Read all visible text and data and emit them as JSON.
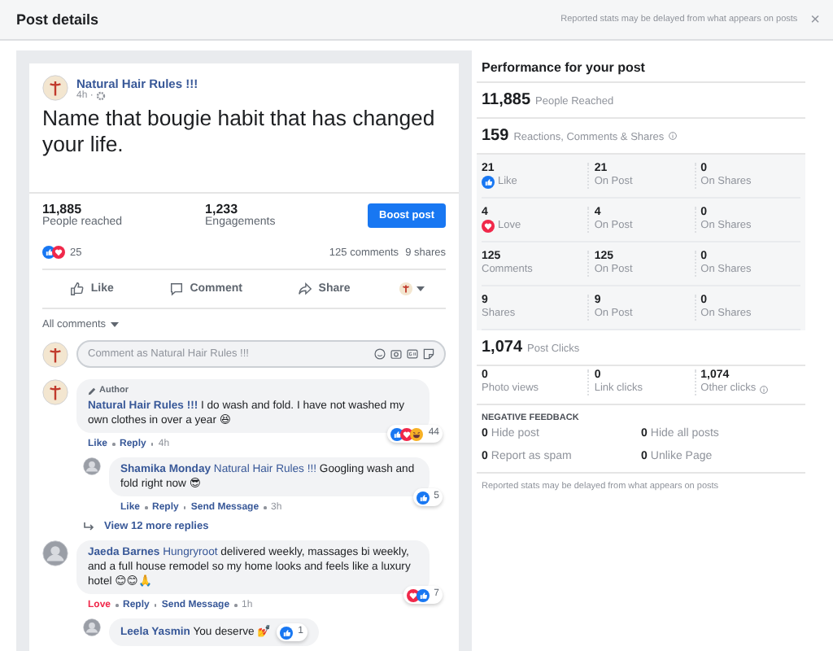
{
  "header": {
    "title": "Post details",
    "note": "Reported stats may be delayed from what appears on posts",
    "close": "×"
  },
  "post": {
    "page_name": "Natural Hair Rules !!!",
    "time": "4h ·",
    "text": "Name that bougie habit that has changed your life.",
    "stats": [
      {
        "value": "11,885",
        "label": "People reached"
      },
      {
        "value": "1,233",
        "label": "Engagements"
      }
    ],
    "boost_button": "Boost post",
    "reactions": {
      "kinds": [
        {
          "kind": "like"
        },
        {
          "kind": "love"
        }
      ],
      "count": "25"
    },
    "comments_count": "125 comments",
    "shares_count": "9 shares",
    "actions": [
      {
        "kind": "like",
        "label": "Like"
      },
      {
        "kind": "comment",
        "label": "Comment"
      },
      {
        "kind": "share",
        "label": "Share"
      }
    ],
    "filter": "All comments",
    "comment_placeholder": "Comment as Natural Hair Rules !!!",
    "comments": [
      {
        "badge": "Author",
        "name": "Natural Hair Rules !!!",
        "text": "I do wash and fold. I have not washed my own clothes in over a year 😆",
        "loved": false,
        "actions": [
          "Like",
          "Reply"
        ],
        "time": "4h",
        "reactions": [
          {
            "kind": "like"
          },
          {
            "kind": "love"
          },
          {
            "kind": "haha"
          }
        ],
        "reaction_count": "44",
        "children": [
          {
            "name": "Shamika Monday",
            "mention": "Natural Hair Rules !!!",
            "text": "Googling wash and fold right now 😎",
            "loved": false,
            "actions": [
              "Like",
              "Reply",
              "Send Message"
            ],
            "time": "3h",
            "reactions": [
              {
                "kind": "like"
              }
            ],
            "reaction_count": "5"
          }
        ],
        "more_replies": "View 12 more replies"
      },
      {
        "name": "Jaeda Barnes",
        "mention": "Hungryroot",
        "text": "delivered weekly, massages bi weekly, and a full house remodel so my home looks and feels like a luxury hotel 😊😊🙏",
        "loved": true,
        "actions": [
          "Love",
          "Reply",
          "Send Message"
        ],
        "time": "1h",
        "reactions": [
          {
            "kind": "love"
          },
          {
            "kind": "like"
          }
        ],
        "reaction_count": "7",
        "children": [
          {
            "name": "Leela Yasmin",
            "text": "You deserve 💅",
            "reactions": [
              {
                "kind": "like"
              }
            ],
            "reaction_count": "1"
          }
        ]
      }
    ]
  },
  "performance": {
    "title": "Performance for your post",
    "reached": {
      "value": "11,885",
      "label": "People Reached"
    },
    "engagement": {
      "value": "159",
      "label": "Reactions, Comments & Shares"
    },
    "engagement_rows": [
      [
        {
          "value": "21",
          "label": "Like",
          "kind": "like"
        },
        {
          "value": "21",
          "label": "On Post"
        },
        {
          "value": "0",
          "label": "On Shares"
        }
      ],
      [
        {
          "value": "4",
          "label": "Love",
          "kind": "love"
        },
        {
          "value": "4",
          "label": "On Post"
        },
        {
          "value": "0",
          "label": "On Shares"
        }
      ],
      [
        {
          "value": "125",
          "label": "Comments"
        },
        {
          "value": "125",
          "label": "On Post"
        },
        {
          "value": "0",
          "label": "On Shares"
        }
      ],
      [
        {
          "value": "9",
          "label": "Shares"
        },
        {
          "value": "9",
          "label": "On Post"
        },
        {
          "value": "0",
          "label": "On Shares"
        }
      ]
    ],
    "clicks": {
      "value": "1,074",
      "label": "Post Clicks"
    },
    "click_cells": [
      {
        "value": "0",
        "label": "Photo views"
      },
      {
        "value": "0",
        "label": "Link clicks"
      },
      {
        "value": "1,074",
        "label": "Other clicks",
        "info": true
      }
    ],
    "negative_heading": "NEGATIVE FEEDBACK",
    "negative": [
      {
        "value": "0",
        "label": "Hide post"
      },
      {
        "value": "0",
        "label": "Hide all posts"
      },
      {
        "value": "0",
        "label": "Report as spam"
      },
      {
        "value": "0",
        "label": "Unlike Page"
      }
    ],
    "footer": "Reported stats may be delayed from what appears on posts"
  }
}
